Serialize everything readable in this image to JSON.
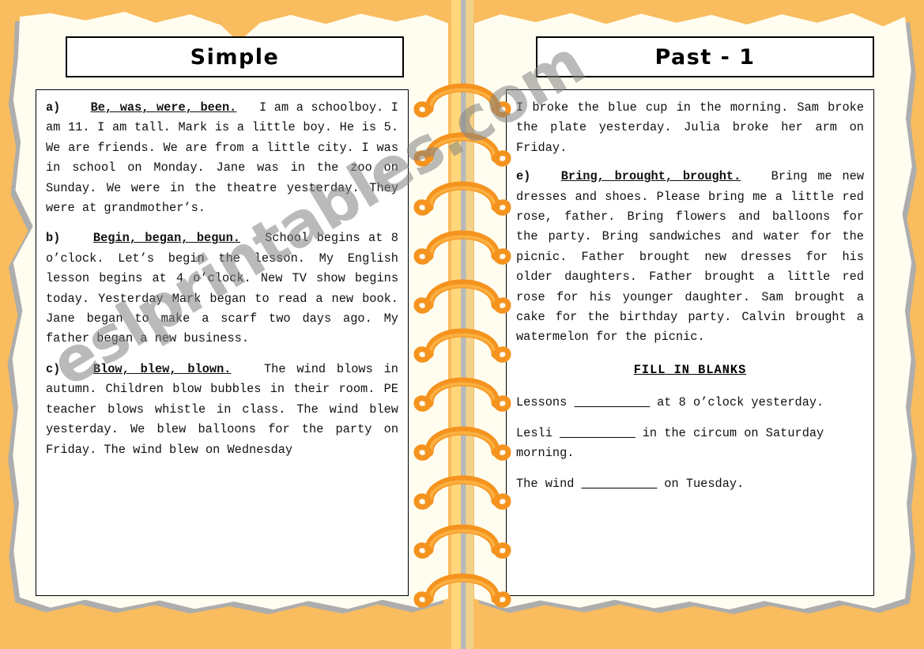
{
  "worksheet": {
    "left_panel": {
      "title": "Simple",
      "sections": [
        {
          "marker": "a)",
          "verb_forms": "Be, was, were, been.",
          "body": "I am a schoolboy. I am 11. I am tall. Mark is a little boy. He is 5. We are friends. We are from a little city. I was in school on Monday. Jane was in the zoo on Sunday. We were in the theatre yesterday. They were at grandmother’s."
        },
        {
          "marker": "b)",
          "verb_forms": "Begin, began, begun.",
          "body": "School begins at 8 o’clock. Let’s begin the lesson. My English lesson begins at 4 o’clock. New TV show begins today. Yesterday Mark began to read a new book. Jane began to make a scarf two days ago. My father began a new business."
        },
        {
          "marker": "c)",
          "verb_forms": "Blow, blew, blown.",
          "body": "The wind blows in autumn. Children blow bubbles in their room. PE teacher blows whistle in class. The wind blew yesterday. We blew balloons for the party on Friday. The wind blew on Wednesday"
        }
      ]
    },
    "right_panel": {
      "title": "Past - 1",
      "continued_text": "I broke the blue cup in the morning. Sam broke the plate yesterday. Julia broke her arm on Friday.",
      "sections": [
        {
          "marker": "e)",
          "verb_forms": "Bring, brought, brought.",
          "body": "Bring me new dresses and shoes. Please bring me a little red rose, father. Bring flowers and balloons for the party. Bring sandwiches and water for the picnic. Father brought new dresses for his older daughters. Father brought a little red rose for his younger daughter. Sam brought a cake for the birthday party. Calvin brought a watermelon for the picnic."
        }
      ],
      "exercise": {
        "heading": "FILL IN BLANKS",
        "blank_glyph": "___________",
        "items": [
          {
            "before": "Lessons ",
            "after": " at 8 o’clock yesterday."
          },
          {
            "before": "Lesli ",
            "after": " in the circum on Saturday morning."
          },
          {
            "before": "The wind ",
            "after": " on Tuesday."
          }
        ]
      }
    },
    "watermark": "eslprintables.com",
    "colors": {
      "background_orange": "#f9bc5e",
      "paper_cream": "#fffdf0",
      "shadow_gray": "#adadad",
      "ring_orange": "#f5931f",
      "ring_light_orange": "#fbb040",
      "spine_yellow": "#ffd77a",
      "text_black": "#111111"
    }
  }
}
